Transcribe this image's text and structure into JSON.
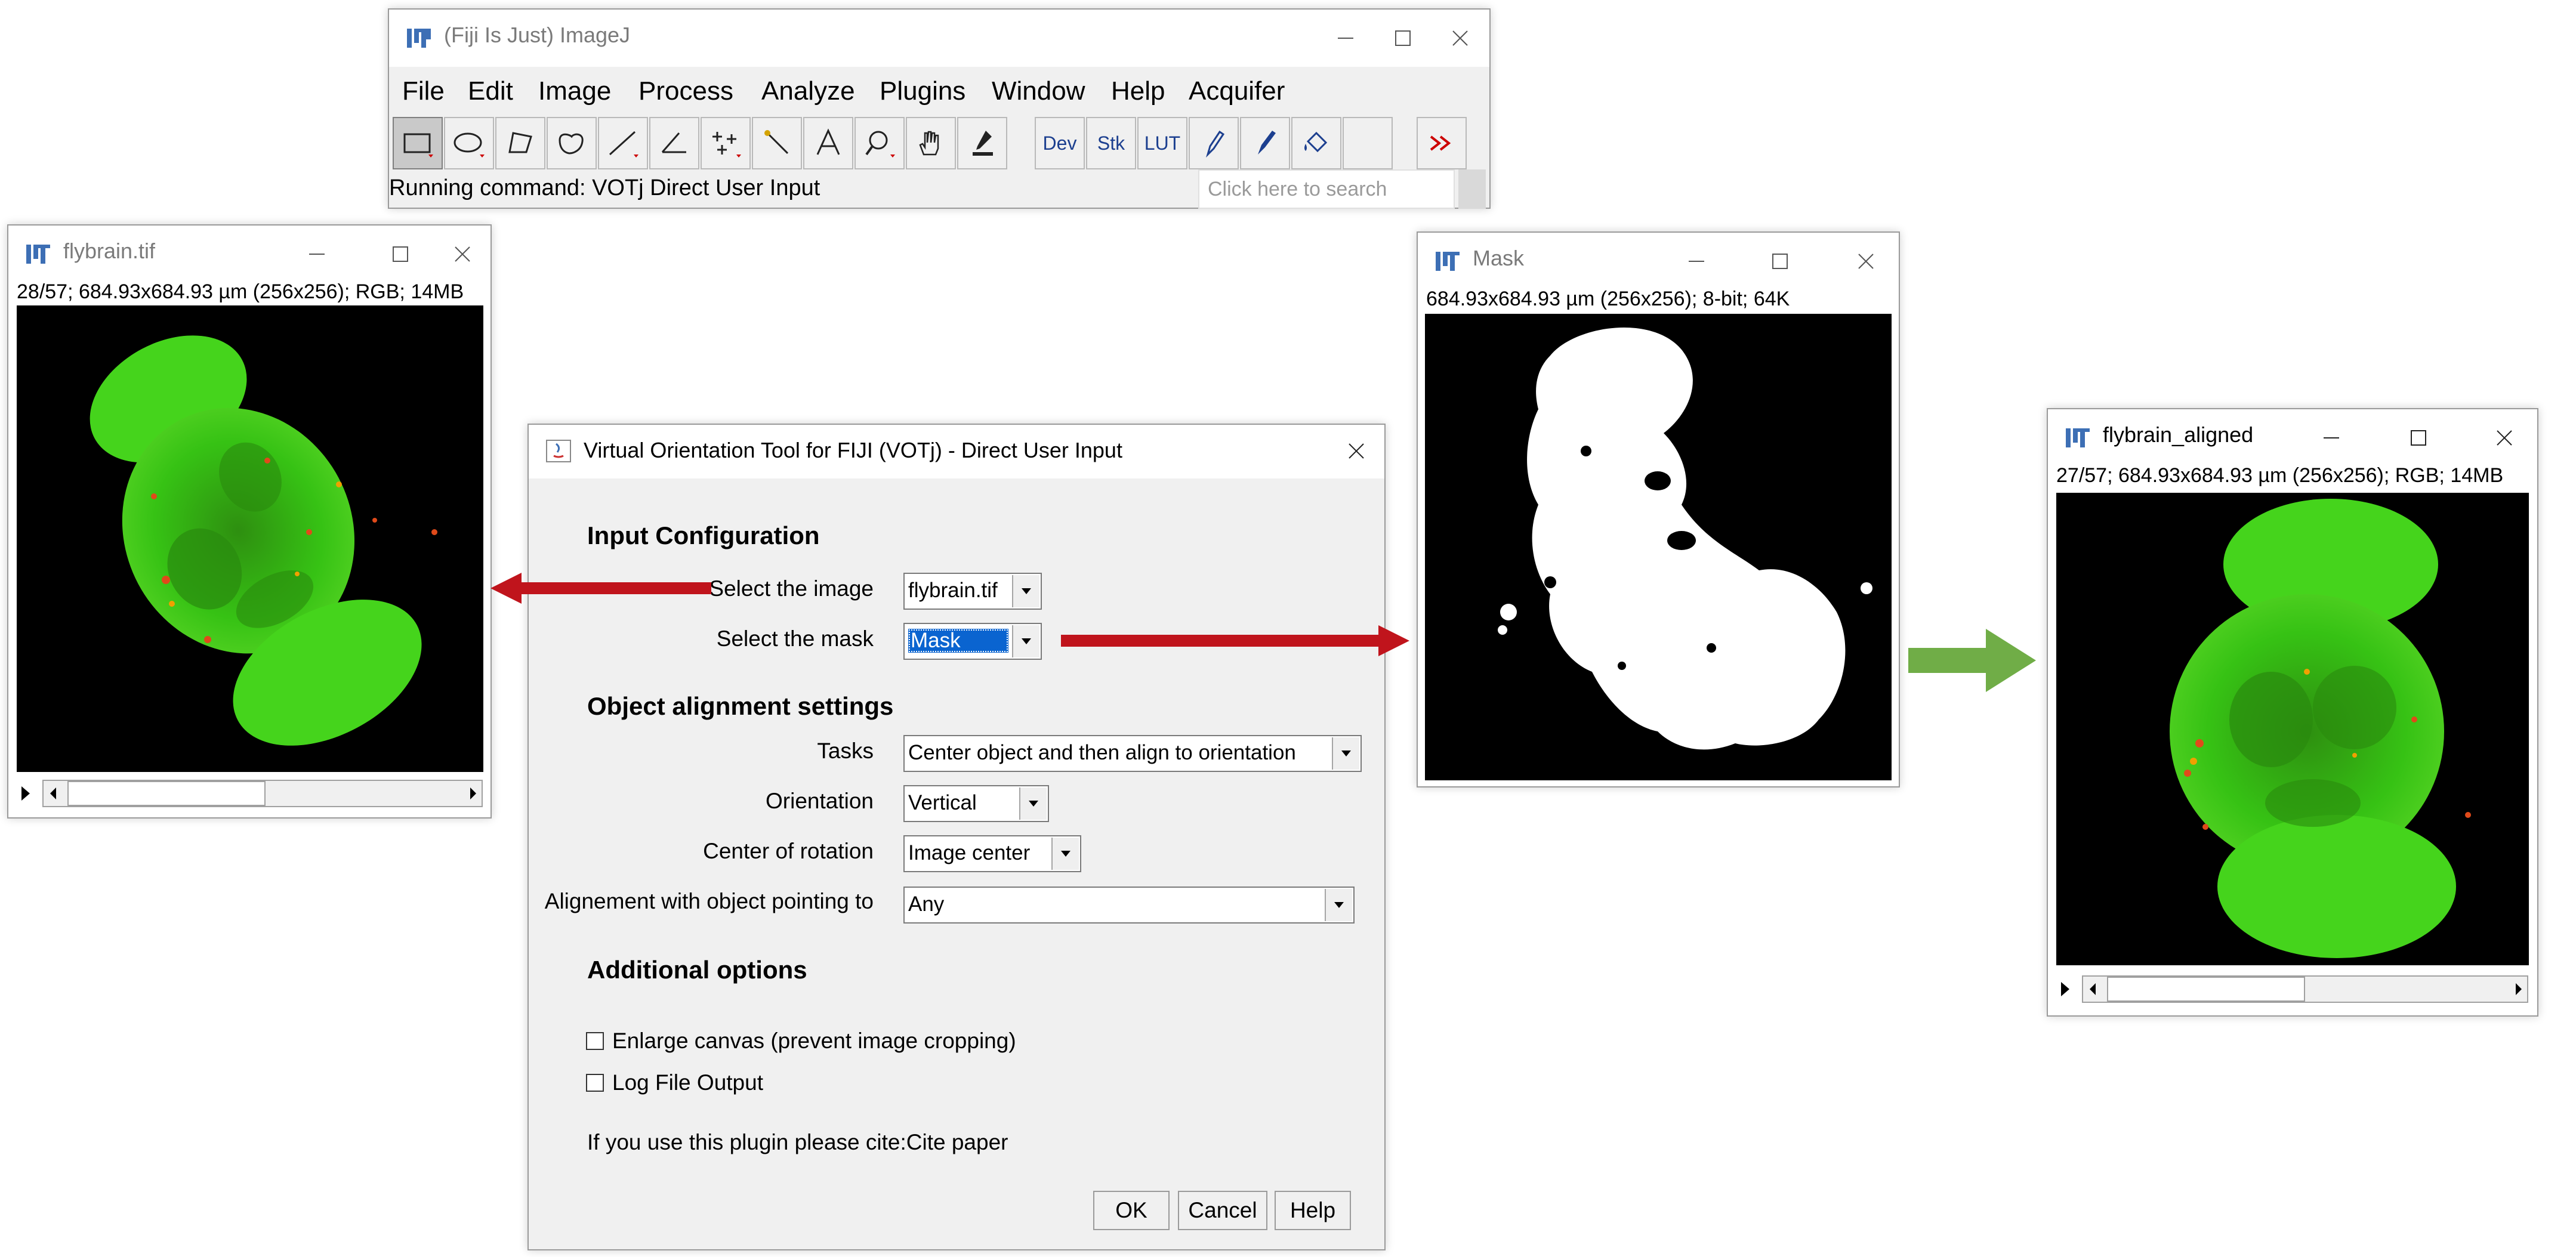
{
  "imagej": {
    "title": "(Fiji Is Just) ImageJ",
    "menus": [
      "File",
      "Edit",
      "Image",
      "Process",
      "Analyze",
      "Plugins",
      "Window",
      "Help",
      "Acquifer"
    ],
    "tools": [
      {
        "icon": "rectangle-tool-icon",
        "selected": true
      },
      {
        "icon": "oval-tool-icon"
      },
      {
        "icon": "polygon-tool-icon"
      },
      {
        "icon": "freehand-tool-icon"
      },
      {
        "icon": "line-tool-icon"
      },
      {
        "icon": "angle-tool-icon"
      },
      {
        "icon": "multipoint-tool-icon"
      },
      {
        "icon": "wand-tool-icon"
      },
      {
        "icon": "text-tool-icon"
      },
      {
        "icon": "magnifier-tool-icon"
      },
      {
        "icon": "hand-tool-icon"
      },
      {
        "icon": "dropper-tool-icon"
      },
      {
        "label": "Dev"
      },
      {
        "label": "Stk"
      },
      {
        "label": "LUT"
      },
      {
        "icon": "pencil-tool-icon"
      },
      {
        "icon": "brush-tool-icon"
      },
      {
        "icon": "flood-fill-tool-icon"
      },
      {
        "icon": "blank-tool"
      },
      {
        "icon": "more-tools-icon"
      }
    ],
    "status": "Running command: VOTj  Direct User Input",
    "search_placeholder": "Click here to search"
  },
  "flybrain": {
    "title": "flybrain.tif",
    "info": "28/57; 684.93x684.93 µm (256x256); RGB; 14MB"
  },
  "mask": {
    "title": "Mask",
    "info": "684.93x684.93 µm (256x256); 8-bit; 64K"
  },
  "aligned": {
    "title": "flybrain_aligned",
    "info": "27/57; 684.93x684.93 µm (256x256); RGB; 14MB"
  },
  "dialog": {
    "title": "Virtual Orientation Tool for FIJI (VOTj) - Direct User Input",
    "input_section": "Input Configuration",
    "select_image_label": "Select the image",
    "select_image_value": "flybrain.tif",
    "select_mask_label": "Select the mask",
    "select_mask_value": "Mask",
    "alignment_section": "Object alignment settings",
    "tasks_label": "Tasks",
    "tasks_value": "Center object and then align to orientation",
    "orientation_label": "Orientation",
    "orientation_value": "Vertical",
    "center_label": "Center of rotation",
    "center_value": "Image center",
    "pointing_label": "Alignement with object pointing to",
    "pointing_value": "Any",
    "additional_section": "Additional options",
    "enlarge_label": "Enlarge canvas (prevent image cropping)",
    "enlarge_checked": false,
    "log_label": "Log File Output",
    "log_checked": false,
    "cite_text": "If you use this plugin please cite:Cite paper",
    "ok": "OK",
    "cancel": "Cancel",
    "help": "Help"
  },
  "colors": {
    "red_arrow": "#c0141c",
    "green_arrow": "#70ad47",
    "brain_green": "#39d617",
    "selection_blue": "#0a64d0"
  }
}
